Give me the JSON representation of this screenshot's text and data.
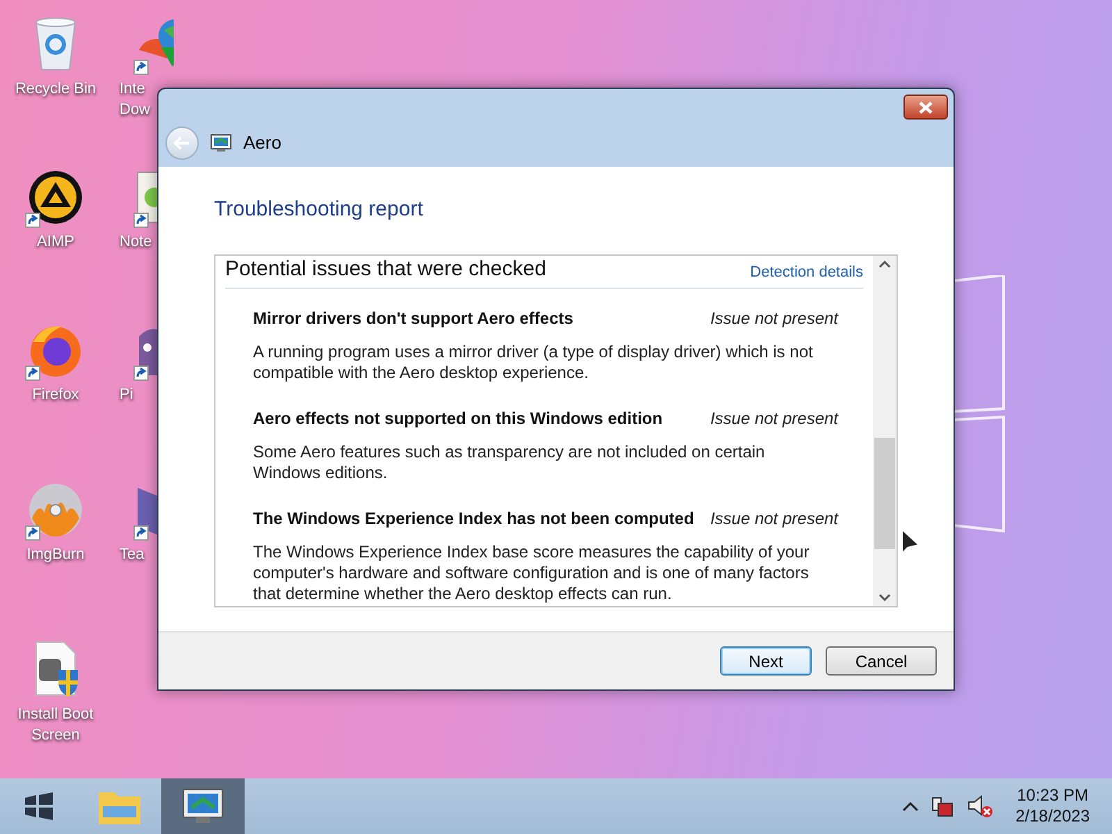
{
  "desktop_icons": [
    {
      "label": [
        "Recycle Bin"
      ],
      "kind": "bin",
      "shortcut": false
    },
    {
      "label": [
        "AIMP"
      ],
      "kind": "aimp",
      "shortcut": true
    },
    {
      "label": [
        "Firefox"
      ],
      "kind": "firefox",
      "shortcut": true
    },
    {
      "label": [
        "ImgBurn"
      ],
      "kind": "disc",
      "shortcut": true
    },
    {
      "label": [
        "Install Boot",
        "Screen"
      ],
      "kind": "installer",
      "shortcut": false
    },
    {
      "label": [
        "Inte",
        "Dow"
      ],
      "kind": "globe",
      "shortcut": true
    },
    {
      "label": [
        "Note"
      ],
      "kind": "notepad",
      "shortcut": true
    },
    {
      "label": [
        "Pi"
      ],
      "kind": "purple",
      "shortcut": true
    },
    {
      "label": [
        "Tea"
      ],
      "kind": "book",
      "shortcut": true
    }
  ],
  "window": {
    "title": "Aero",
    "heading": "Troubleshooting report",
    "panel": {
      "title": "Potential issues that were checked",
      "link": "Detection details",
      "issues": [
        {
          "title": "Mirror drivers don't support Aero effects",
          "status": "Issue not present",
          "description": "A running program uses a mirror driver (a type of display driver) which is not compatible with the Aero desktop experience."
        },
        {
          "title": "Aero effects not supported on this Windows edition",
          "status": "Issue not present",
          "description": "Some Aero features such as transparency are not included on certain Windows editions."
        },
        {
          "title": "The Windows Experience Index has not been computed",
          "status": "Issue not present",
          "description": "The Windows Experience Index base score measures the capability of your computer's hardware and software configuration and is one of many factors that determine whether the Aero desktop effects can run."
        }
      ]
    },
    "buttons": [
      {
        "label": "Next",
        "default": true
      },
      {
        "label": "Cancel",
        "default": false
      }
    ]
  },
  "taskbar": {
    "apps": [
      {
        "kind": "explorer",
        "selected": false
      },
      {
        "kind": "aero",
        "selected": true
      }
    ],
    "time": "10:23 PM",
    "date": "2/18/2023"
  }
}
